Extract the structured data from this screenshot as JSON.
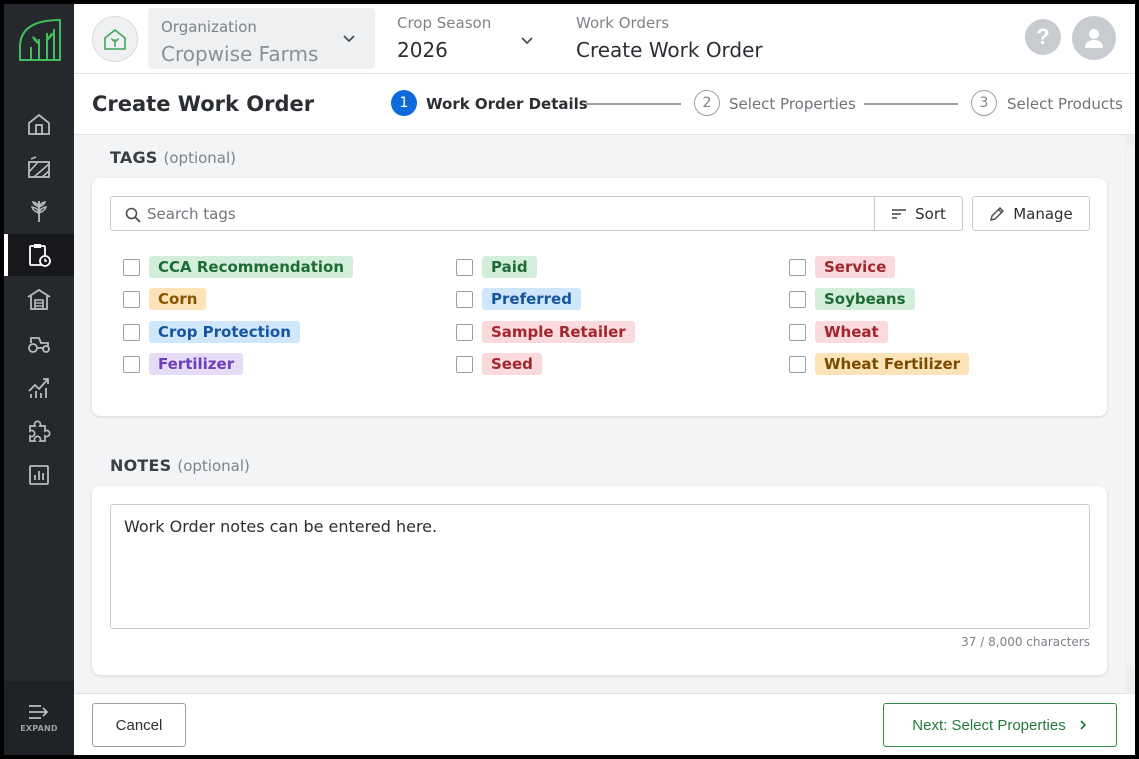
{
  "sidebar": {
    "nav": [
      {
        "name": "home-icon"
      },
      {
        "name": "fields-icon"
      },
      {
        "name": "crops-icon"
      },
      {
        "name": "work-orders-icon",
        "active": true
      },
      {
        "name": "warehouse-icon"
      },
      {
        "name": "equipment-icon"
      },
      {
        "name": "analytics-icon"
      },
      {
        "name": "integrations-icon"
      },
      {
        "name": "reports-icon"
      }
    ],
    "expand_label": "EXPAND"
  },
  "header": {
    "organization_label": "Organization",
    "organization_value": "Cropwise Farms",
    "crop_season_label": "Crop Season",
    "crop_season_value": "2026",
    "breadcrumb_parent": "Work Orders",
    "breadcrumb_current": "Create Work Order",
    "help_glyph": "?"
  },
  "page": {
    "title": "Create Work Order",
    "steps": [
      {
        "number": "1",
        "label": "Work Order Details",
        "active": true
      },
      {
        "number": "2",
        "label": "Select Properties",
        "active": false
      },
      {
        "number": "3",
        "label": "Select Products",
        "active": false
      }
    ]
  },
  "tags_section": {
    "title": "TAGS",
    "optional": "(optional)",
    "search_placeholder": "Search tags",
    "sort_label": "Sort",
    "manage_label": "Manage",
    "columns": [
      [
        {
          "label": "CCA Recommendation",
          "style": "green"
        },
        {
          "label": "Corn",
          "style": "orange"
        },
        {
          "label": "Crop Protection",
          "style": "blue"
        },
        {
          "label": "Fertilizer",
          "style": "purple"
        }
      ],
      [
        {
          "label": "Paid",
          "style": "green"
        },
        {
          "label": "Preferred",
          "style": "blue"
        },
        {
          "label": "Sample Retailer",
          "style": "red"
        },
        {
          "label": "Seed",
          "style": "red"
        }
      ],
      [
        {
          "label": "Service",
          "style": "red"
        },
        {
          "label": "Soybeans",
          "style": "green"
        },
        {
          "label": "Wheat",
          "style": "red"
        },
        {
          "label": "Wheat Fertilizer",
          "style": "yellow"
        }
      ]
    ]
  },
  "notes_section": {
    "title": "NOTES",
    "optional": "(optional)",
    "value": "Work Order notes can be entered here.",
    "char_count": "37 / 8,000 characters"
  },
  "footer": {
    "cancel_label": "Cancel",
    "next_label": "Next: Select Properties"
  },
  "colors": {
    "sidebar_bg": "#25282c",
    "accent_blue": "#0d6bd9",
    "primary_green": "#237a3b"
  }
}
